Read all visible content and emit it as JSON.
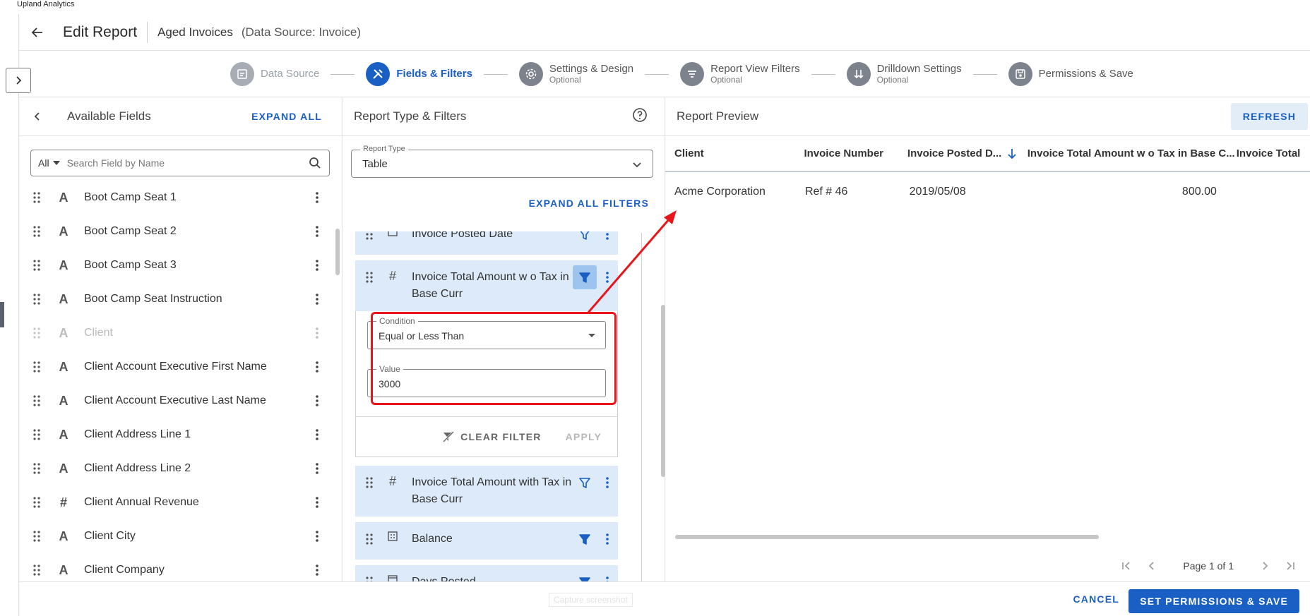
{
  "app": {
    "name": "Upland Analytics"
  },
  "header": {
    "title": "Edit Report",
    "report_name": "Aged Invoices",
    "data_source": "(Data Source: Invoice)"
  },
  "steps": [
    {
      "label": "Data Source",
      "sub": "",
      "state": "done",
      "icon": "document-icon"
    },
    {
      "label": "Fields & Filters",
      "sub": "",
      "state": "active",
      "icon": "tools-icon"
    },
    {
      "label": "Settings & Design",
      "sub": "Optional",
      "state": "optional",
      "icon": "gear-icon"
    },
    {
      "label": "Report View Filters",
      "sub": "Optional",
      "state": "optional",
      "icon": "filter-icon"
    },
    {
      "label": "Drilldown Settings",
      "sub": "Optional",
      "state": "optional",
      "icon": "sort-arrows-icon"
    },
    {
      "label": "Permissions & Save",
      "sub": "",
      "state": "pending",
      "icon": "save-icon"
    }
  ],
  "available_fields": {
    "title": "Available Fields",
    "expand_all": "EXPAND ALL",
    "search": {
      "scope": "All",
      "placeholder": "Search Field by Name"
    },
    "items": [
      {
        "name": "Boot Camp Seat 1",
        "type": "A",
        "disabled": false
      },
      {
        "name": "Boot Camp Seat 2",
        "type": "A",
        "disabled": false
      },
      {
        "name": "Boot Camp Seat 3",
        "type": "A",
        "disabled": false
      },
      {
        "name": "Boot Camp Seat Instruction",
        "type": "A",
        "disabled": false
      },
      {
        "name": "Client",
        "type": "A",
        "disabled": true
      },
      {
        "name": "Client Account Executive First Name",
        "type": "A",
        "disabled": false
      },
      {
        "name": "Client Account Executive Last Name",
        "type": "A",
        "disabled": false
      },
      {
        "name": "Client Address Line 1",
        "type": "A",
        "disabled": false
      },
      {
        "name": "Client Address Line 2",
        "type": "A",
        "disabled": false
      },
      {
        "name": "Client Annual Revenue",
        "type": "#",
        "disabled": false
      },
      {
        "name": "Client City",
        "type": "A",
        "disabled": false
      },
      {
        "name": "Client Company",
        "type": "A",
        "disabled": false
      }
    ]
  },
  "report_type_filters": {
    "title": "Report Type & Filters",
    "report_type": {
      "label": "Report Type",
      "value": "Table"
    },
    "expand_all_filters": "EXPAND ALL FILTERS",
    "filter_items": [
      {
        "name": "Invoice Posted Date",
        "type": "calendar-icon",
        "funnel": "outline"
      },
      {
        "name": "Invoice Total Amount w o Tax in Base Curr",
        "type": "#",
        "funnel": "active"
      }
    ],
    "editor": {
      "condition_label": "Condition",
      "condition_value": "Equal or Less Than",
      "value_label": "Value",
      "value": "3000",
      "clear_filter": "CLEAR FILTER",
      "apply": "APPLY"
    },
    "filter_items_after": [
      {
        "name": "Invoice Total Amount with Tax in Base Curr",
        "type": "#",
        "funnel": "outline"
      },
      {
        "name": "Balance",
        "type": "calculator-icon",
        "funnel": "filled"
      },
      {
        "name": "Days Posted",
        "type": "calendar-icon",
        "funnel": "filled"
      }
    ]
  },
  "preview": {
    "title": "Report Preview",
    "refresh": "REFRESH",
    "columns": [
      "Client",
      "Invoice Number",
      "Invoice Posted D...",
      "Invoice Total Amount w o Tax in Base C...",
      "Invoice Total"
    ],
    "rows": [
      [
        "Acme Corporation",
        "Ref # 46",
        "2019/05/08",
        "800.00",
        ""
      ]
    ],
    "pagination": {
      "text": "Page  1 of 1"
    }
  },
  "footer": {
    "hint": "Capture screenshot",
    "cancel": "CANCEL",
    "save": "SET PERMISSIONS & SAVE"
  },
  "colors": {
    "accent": "#1a5fc4",
    "annotation": "#e8161c",
    "filter_bg": "#dceafa"
  }
}
